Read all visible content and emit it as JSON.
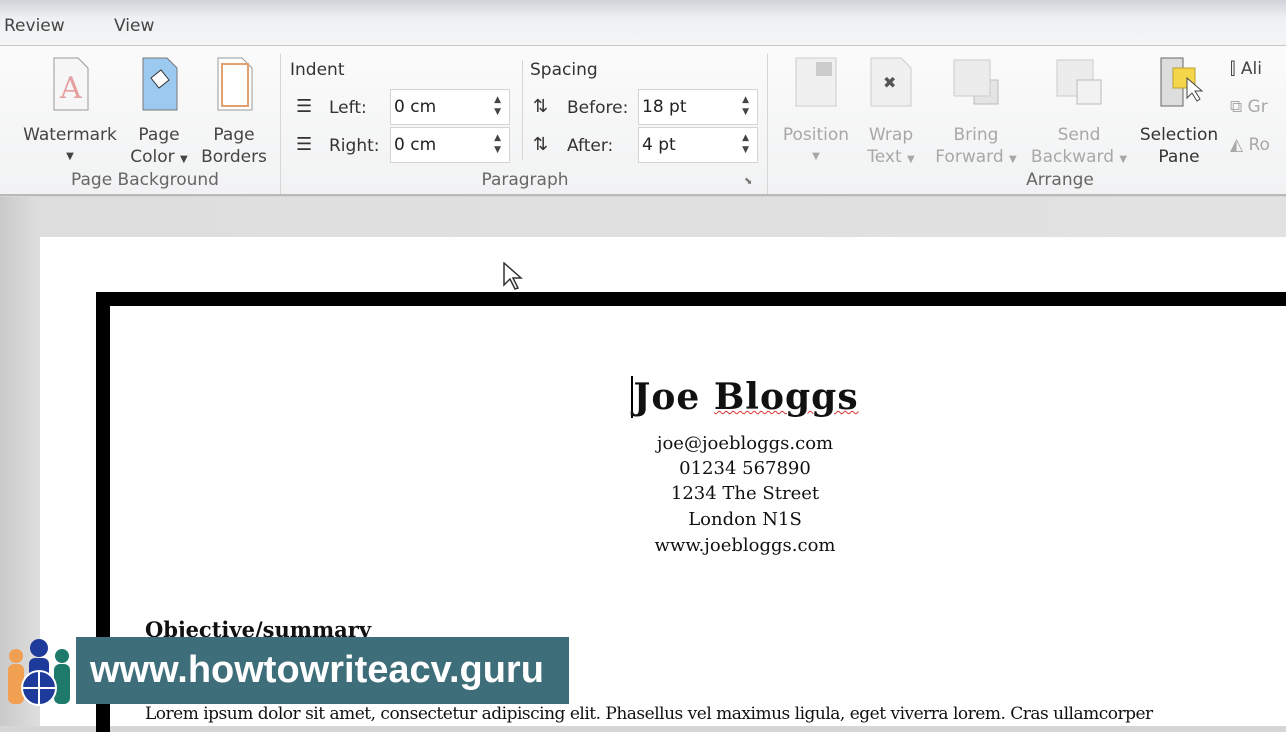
{
  "tabs": [
    "Review",
    "View"
  ],
  "page_background": {
    "label": "Page Background",
    "watermark": "Watermark",
    "page_color": [
      "Page",
      "Color"
    ],
    "page_borders": [
      "Page",
      "Borders"
    ]
  },
  "paragraph": {
    "label": "Paragraph",
    "indent": "Indent",
    "left_label": "Left:",
    "left_value": "0 cm",
    "right_label": "Right:",
    "right_value": "0 cm",
    "spacing": "Spacing",
    "before_label": "Before:",
    "before_value": "18 pt",
    "after_label": "After:",
    "after_value": "4 pt"
  },
  "arrange": {
    "label": "Arrange",
    "position": "Position",
    "wrap_text": [
      "Wrap",
      "Text"
    ],
    "bring_forward": [
      "Bring",
      "Forward"
    ],
    "send_backward": [
      "Send",
      "Backward"
    ],
    "selection_pane": [
      "Selection",
      "Pane"
    ],
    "align": "Ali",
    "group": "Gr",
    "rotate": "Ro"
  },
  "document": {
    "name": "Joe Bloggs",
    "name_first": "Joe ",
    "name_last": "Bloggs",
    "contact": [
      "joe@joebloggs.com",
      "01234 567890",
      "1234 The Street",
      "London N1S",
      "www.joebloggs.com"
    ],
    "heading": "Objective/summary",
    "body": "Lorem ipsum dolor sit amet, consectetur adipiscing elit. Phasellus vel maximus ligula, eget viverra lorem. Cras ullamcorper"
  },
  "watermark_banner": "www.howtowriteacv.guru",
  "colors": {
    "banner": "#3d6e7a",
    "border": "#000000"
  }
}
